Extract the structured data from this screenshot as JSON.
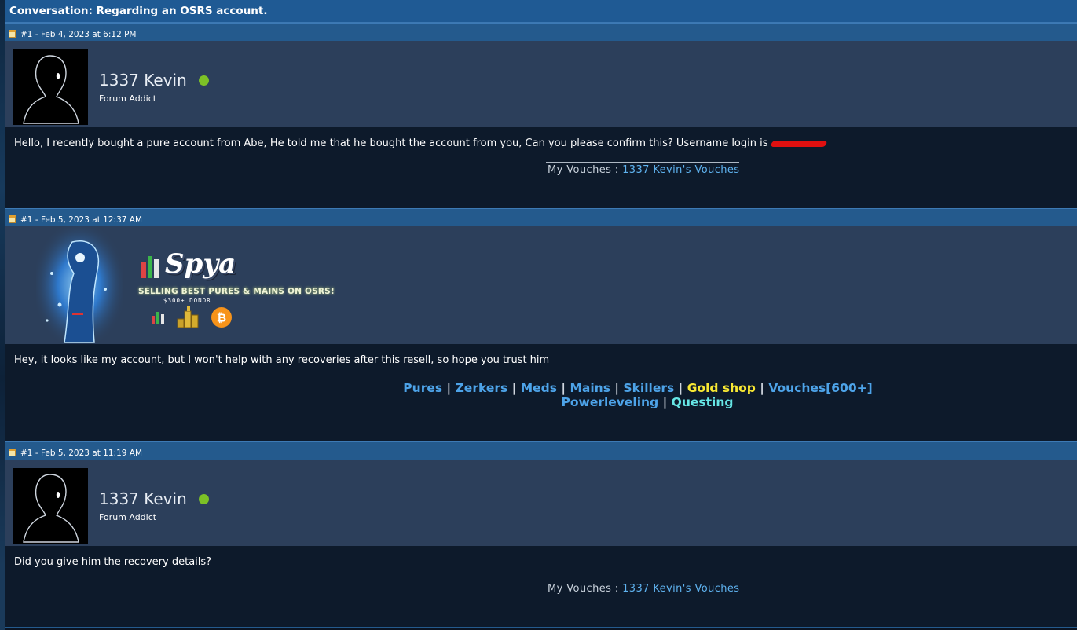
{
  "conversation": {
    "title": "Conversation: Regarding an OSRS account."
  },
  "posts": [
    {
      "meta": "#1 - Feb 4, 2023 at 6:12 PM",
      "author": "1337 Kevin",
      "rank": "Forum Addict",
      "online": true,
      "message": "Hello, I recently bought a pure account from Abe, He told me that he bought the account from you, Can you please confirm this? Username login is ",
      "signature": {
        "prefix": "My Vouches : ",
        "link": "1337 Kevin's Vouches"
      }
    },
    {
      "meta": "#1 - Feb 5, 2023 at 12:37 AM",
      "banner": {
        "brand": "Spya",
        "tagline": "SELLING BEST PURES & MAINS ON OSRS!",
        "badge": "$300+ DONOR",
        "icons": [
          "bar-chart-icon",
          "gold-coins-icon",
          "bitcoin-icon"
        ]
      },
      "message": "Hey, it looks like my account, but I won't help with any recoveries after this resell, so hope you trust him",
      "signature_links": {
        "row1": [
          "Pures",
          "Zerkers",
          "Meds",
          "Mains",
          "Skillers",
          "Gold shop",
          "Vouches[600+]"
        ],
        "row2": [
          "Powerleveling",
          "Questing"
        ],
        "separator": "|"
      }
    },
    {
      "meta": "#1 - Feb 5, 2023 at 11:19 AM",
      "author": "1337 Kevin",
      "rank": "Forum Addict",
      "online": true,
      "message": "Did you give him the recovery details?",
      "signature": {
        "prefix": "My Vouches : ",
        "link": "1337 Kevin's Vouches"
      }
    }
  ],
  "colors": {
    "header": "#1f5a94",
    "post_header": "#245a8d",
    "author_bar": "#2c3f5b",
    "body": "#0d1a2b",
    "link": "#5fb3f0",
    "gold_link": "#f7e733",
    "online": "#7cc126"
  }
}
